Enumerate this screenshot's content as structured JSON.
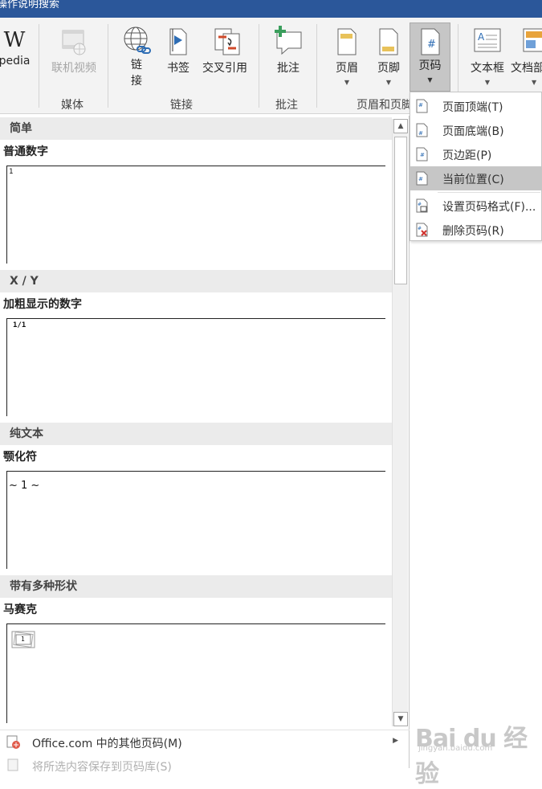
{
  "titlebar": {
    "search_text": "操作说明搜索"
  },
  "ribbon": {
    "wikipedia_label": "pedia",
    "online_video_label": "联机视频",
    "link_label_line1": "链",
    "link_label_line2": "接",
    "bookmark_label": "书签",
    "cross_ref_label": "交叉引用",
    "comment_label": "批注",
    "header_label": "页眉",
    "footer_label": "页脚",
    "page_number_label": "页码",
    "textbox_label": "文本框",
    "docparts_label": "文档部",
    "groups": {
      "media": "媒体",
      "links": "链接",
      "comments": "批注",
      "header_footer": "页眉和页脚"
    }
  },
  "gallery": {
    "sections": [
      {
        "header": "简单",
        "subtitle": "普通数字",
        "sample": "1"
      },
      {
        "header": "X / Y",
        "subtitle": "加粗显示的数字",
        "sample": "1/1"
      },
      {
        "header": "纯文本",
        "subtitle": "颚化符",
        "sample": "~ 1 ~"
      },
      {
        "header": "带有多种形状",
        "subtitle": "马赛克",
        "sample": "1"
      }
    ],
    "more_online": "Office.com 中的其他页码(M)",
    "save_selection": "将所选内容保存到页码库(S)"
  },
  "page_number_menu": {
    "items": [
      {
        "label": "页面顶端(T)"
      },
      {
        "label": "页面底端(B)"
      },
      {
        "label": "页边距(P)"
      },
      {
        "label": "当前位置(C)"
      },
      {
        "label": "设置页码格式(F)..."
      },
      {
        "label": "删除页码(R)"
      }
    ]
  },
  "watermark": {
    "brand": "Bai du 经验",
    "url": "jingyan.baidu.com"
  },
  "colors": {
    "titlebar": "#2b579a",
    "ribbon": "#f3f3f3",
    "selected": "#c6c6c6"
  }
}
